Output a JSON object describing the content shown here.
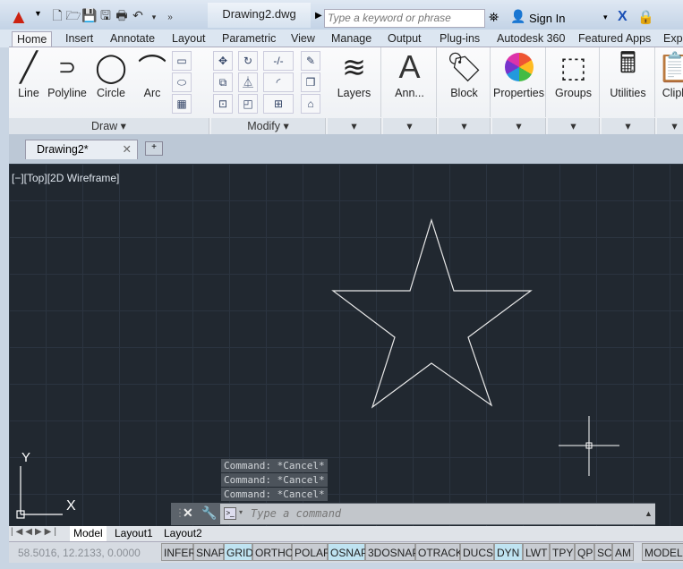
{
  "title_bar": {
    "document_title": "Drawing2.dwg",
    "search_placeholder": "Type a keyword or phrase",
    "sign_in": "Sign In"
  },
  "ribbon_tabs": [
    "Home",
    "Insert",
    "Annotate",
    "Layout",
    "Parametric",
    "View",
    "Manage",
    "Output",
    "Plug-ins",
    "Autodesk 360",
    "Featured Apps",
    "Expr"
  ],
  "draw_tools": [
    "Line",
    "Polyline",
    "Circle",
    "Arc"
  ],
  "panels": {
    "draw": "Draw",
    "modify": "Modify"
  },
  "big_tools": [
    "Layers",
    "Ann...",
    "Block",
    "Properties",
    "Groups",
    "Utilities",
    "Clipb"
  ],
  "document_tab": "Drawing2*",
  "viewport_label": "[−][Top][2D Wireframe]",
  "ucs": {
    "x": "X",
    "y": "Y"
  },
  "command_history": [
    "Command: *Cancel*",
    "Command: *Cancel*",
    "Command: *Cancel*"
  ],
  "command_placeholder": "Type a command",
  "layout_tabs": [
    "Model",
    "Layout1",
    "Layout2"
  ],
  "status": {
    "coords": "58.5016, 12.2133, 0.0000",
    "buttons": [
      {
        "label": "INFER",
        "on": false
      },
      {
        "label": "SNAP",
        "on": false
      },
      {
        "label": "GRID",
        "on": true
      },
      {
        "label": "ORTHO",
        "on": false
      },
      {
        "label": "POLAR",
        "on": false
      },
      {
        "label": "OSNAP",
        "on": true
      },
      {
        "label": "3DOSNAP",
        "on": false
      },
      {
        "label": "OTRACK",
        "on": false
      },
      {
        "label": "DUCS",
        "on": false
      },
      {
        "label": "DYN",
        "on": true
      },
      {
        "label": "LWT",
        "on": false
      },
      {
        "label": "TPY",
        "on": false
      },
      {
        "label": "QP",
        "on": false
      },
      {
        "label": "SC",
        "on": false
      },
      {
        "label": "AM",
        "on": false
      }
    ],
    "model": "MODEL"
  }
}
